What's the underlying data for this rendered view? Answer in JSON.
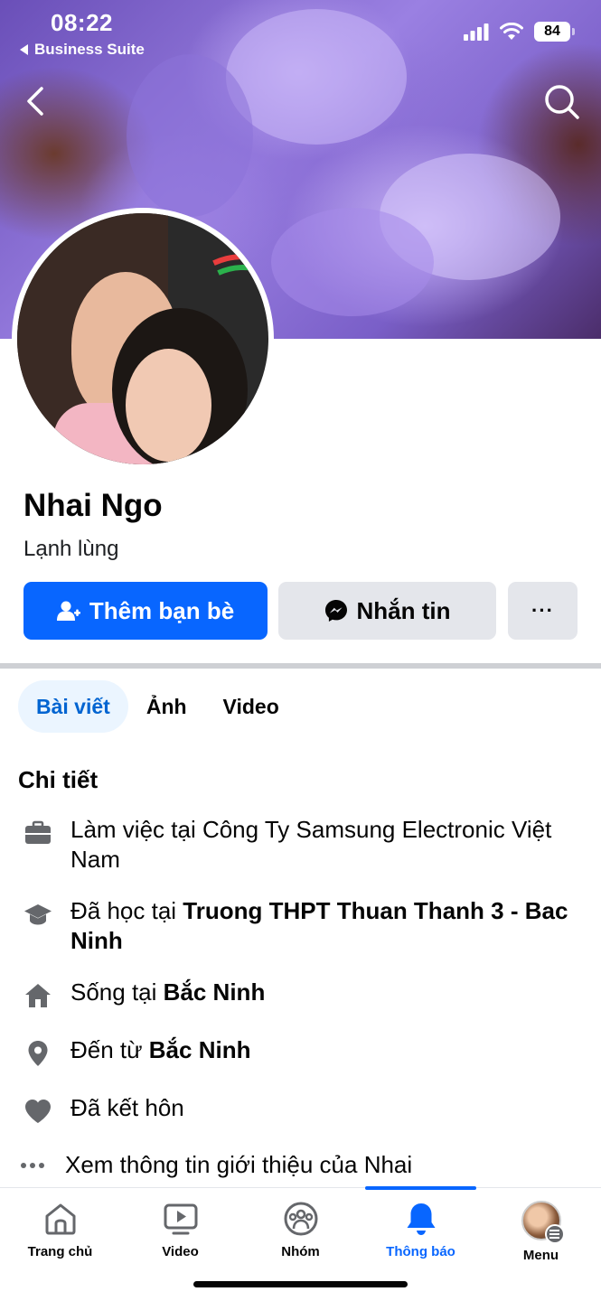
{
  "status_bar": {
    "time": "08:22",
    "back_app": "Business Suite",
    "battery": "84"
  },
  "profile": {
    "name": "Nhai Ngo",
    "bio": "Lạnh lùng",
    "add_friend_label": "Thêm bạn bè",
    "message_label": "Nhắn tin",
    "more_label": "···"
  },
  "tabs": [
    {
      "label": "Bài viết",
      "active": true
    },
    {
      "label": "Ảnh",
      "active": false
    },
    {
      "label": "Video",
      "active": false
    }
  ],
  "details": {
    "title": "Chi tiết",
    "work": {
      "text": "Làm việc tại Công Ty Samsung Electronic Việt Nam"
    },
    "education": {
      "prefix": "Đã học tại ",
      "place": "Truong THPT Thuan Thanh 3 - Bac Ninh"
    },
    "lives": {
      "prefix": "Sống tại ",
      "place": "Bắc Ninh"
    },
    "from": {
      "prefix": "Đến từ ",
      "place": "Bắc Ninh"
    },
    "relationship": {
      "text": "Đã kết hôn"
    },
    "see_more": "Xem thông tin giới thiệu của Nhai"
  },
  "bottom_nav": [
    {
      "label": "Trang chủ",
      "icon": "home-icon",
      "active": false
    },
    {
      "label": "Video",
      "icon": "video-icon",
      "active": false
    },
    {
      "label": "Nhóm",
      "icon": "groups-icon",
      "active": false
    },
    {
      "label": "Thông báo",
      "icon": "bell-icon",
      "active": true
    },
    {
      "label": "Menu",
      "icon": "menu-avatar",
      "active": false
    }
  ],
  "colors": {
    "brand_blue": "#0866ff",
    "button_gray": "#e4e6eb",
    "tab_active_bg": "#ebf5ff"
  }
}
